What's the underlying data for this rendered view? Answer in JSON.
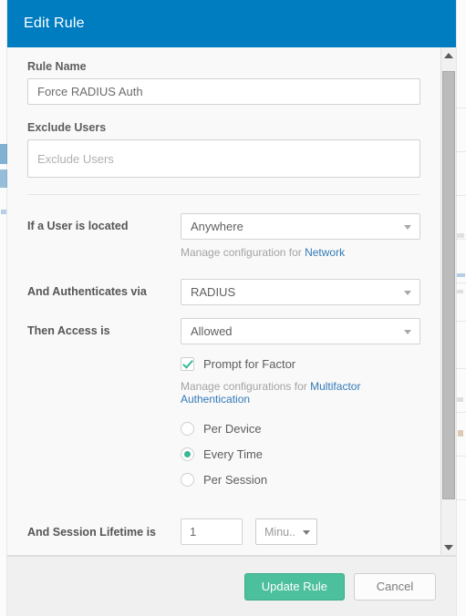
{
  "modal": {
    "title": "Edit Rule",
    "header_color": "#007dc1"
  },
  "form": {
    "rule_name": {
      "label": "Rule Name",
      "value": "Force RADIUS Auth"
    },
    "exclude_users": {
      "label": "Exclude Users",
      "value": "",
      "placeholder": "Exclude Users"
    },
    "location": {
      "label": "If a User is located",
      "selected": "Anywhere",
      "hint_prefix": "Manage configuration for ",
      "hint_link": "Network"
    },
    "authenticates_via": {
      "label": "And Authenticates via",
      "selected": "RADIUS"
    },
    "access": {
      "label": "Then Access is",
      "selected": "Allowed"
    },
    "prompt_for_factor": {
      "label": "Prompt for Factor",
      "checked": true,
      "hint_prefix": "Manage configurations for ",
      "hint_link": "Multifactor Authentication"
    },
    "frequency": {
      "selected": "Every Time",
      "options": [
        {
          "label": "Per Device",
          "selected": false
        },
        {
          "label": "Every Time",
          "selected": true
        },
        {
          "label": "Per Session",
          "selected": false
        }
      ]
    },
    "session_lifetime": {
      "label": "And Session Lifetime is",
      "value": "1",
      "unit": "Minu.."
    }
  },
  "footer": {
    "primary_label": "Update Rule",
    "secondary_label": "Cancel",
    "primary_color": "#4cbf9c"
  },
  "scrollbar": {
    "up_icon": "triangle-up-icon",
    "down_icon": "triangle-down-icon"
  }
}
